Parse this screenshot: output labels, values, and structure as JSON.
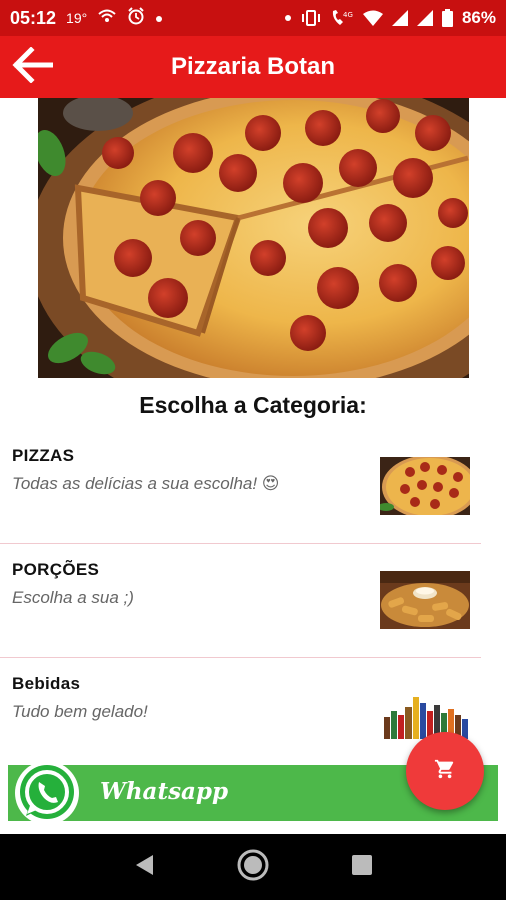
{
  "status_bar": {
    "time": "05:12",
    "temperature": "19°",
    "battery": "86%"
  },
  "app_bar": {
    "title": "Pizzaria Botan"
  },
  "main": {
    "section_title": "Escolha a Categoria:",
    "categories": [
      {
        "name": "PIZZAS",
        "description": "Todas as delícias a sua escolha! 😍",
        "thumb_icon": "pizza-thumbnail"
      },
      {
        "name": "PORÇÕES",
        "description": "Escolha a sua ;)",
        "thumb_icon": "portions-thumbnail"
      },
      {
        "name": "Bebidas",
        "description": "Tudo bem gelado!",
        "thumb_icon": "drinks-thumbnail"
      }
    ]
  },
  "whatsapp_banner": {
    "label": "Whatsapp"
  },
  "colors": {
    "status_bar": "#c81010",
    "app_bar": "#e61a1a",
    "fab": "#ef3a3a",
    "whatsapp": "#4db84a",
    "divider": "#f1c9cf"
  },
  "icons": {
    "back": "arrow-left-icon",
    "fab": "shopping-cart-icon",
    "whatsapp": "whatsapp-icon",
    "nav": [
      "nav-back-icon",
      "nav-home-icon",
      "nav-recents-icon"
    ]
  }
}
